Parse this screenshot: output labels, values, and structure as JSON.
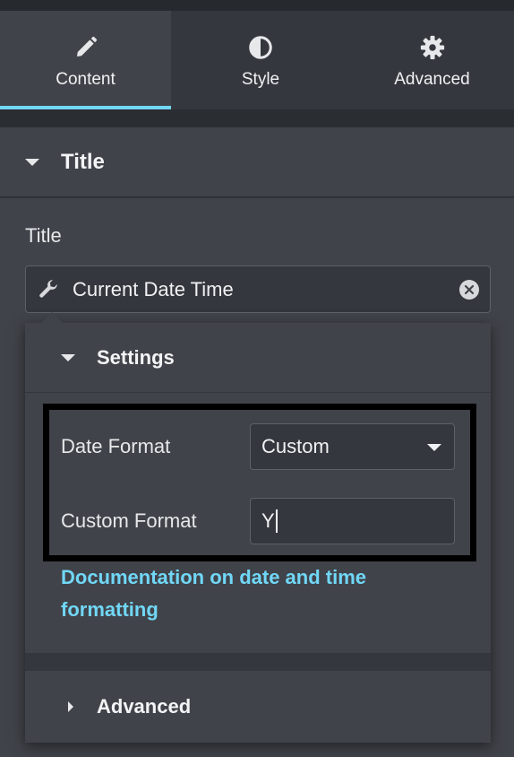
{
  "tabs": [
    {
      "label": "Content",
      "icon": "pencil-icon",
      "active": true
    },
    {
      "label": "Style",
      "icon": "contrast-icon",
      "active": false
    },
    {
      "label": "Advanced",
      "icon": "gear-icon",
      "active": false
    }
  ],
  "section": {
    "title": "Title"
  },
  "title_field": {
    "label": "Title",
    "value": "Current Date Time",
    "icon": "wrench-icon"
  },
  "popover": {
    "settings_label": "Settings",
    "date_format": {
      "label": "Date Format",
      "value": "Custom"
    },
    "custom_format": {
      "label": "Custom Format",
      "value": "Y"
    },
    "doc_link": "Documentation on date and time formatting",
    "advanced_label": "Advanced"
  },
  "colors": {
    "accent": "#71d7f7",
    "panel": "#404349",
    "background": "#34373d"
  }
}
